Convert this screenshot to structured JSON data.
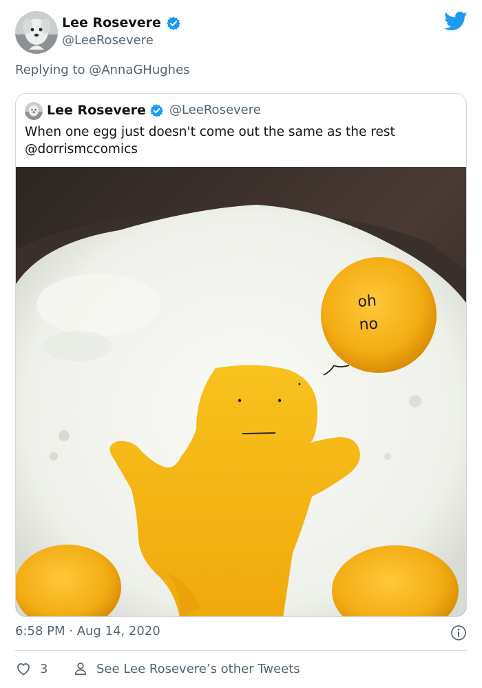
{
  "author": {
    "name": "Lee Rosevere",
    "handle": "@LeeRosevere"
  },
  "reply": {
    "text": "Replying to @AnnaGHughes"
  },
  "quoted_tweet": {
    "name": "Lee Rosevere",
    "handle": "@LeeRosevere",
    "text_line1": "When one egg just doesn't come out the same as the rest",
    "text_line2": "@dorrismccomics",
    "image_doodle_text": "oh no"
  },
  "meta": {
    "timestamp": "6:58 PM · Aug 14, 2020"
  },
  "actions": {
    "like_count": "3",
    "other_tweets_label": "See Lee Rosevere’s other Tweets"
  },
  "colors": {
    "brand": "#1d9bf0",
    "secondary_text": "#536471",
    "border": "#cfd9de",
    "yolk": "#f6b41a"
  },
  "icons": [
    "avatar",
    "verified-badge-icon",
    "twitter-bird-icon",
    "info-icon",
    "heart-icon",
    "person-icon"
  ]
}
